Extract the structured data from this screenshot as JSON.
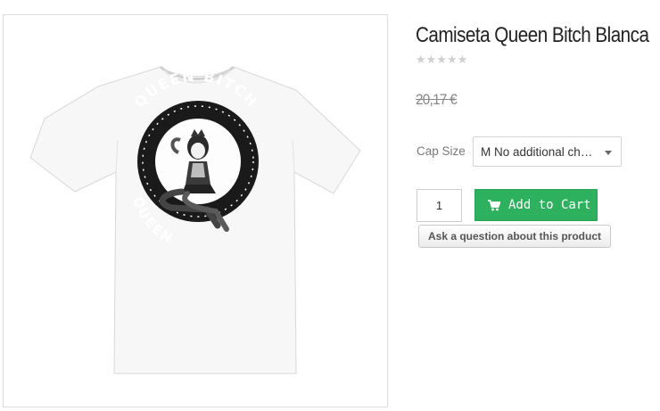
{
  "product": {
    "title": "Camiseta Queen Bitch Blanca",
    "rating_stars": "★★★★★",
    "rating_value": 0,
    "price": "20,17 €"
  },
  "logo_text": {
    "top": "QUEEN BITCH",
    "bottom": "QUEEN"
  },
  "options": {
    "label": "Cap Size",
    "selected": "M No additional charge"
  },
  "cart": {
    "quantity": "1",
    "add_label": "Add to Cart",
    "icon": "shopping-cart-icon"
  },
  "ask_label": "Ask a question about this product",
  "colors": {
    "accent": "#2eb15f",
    "price": "#888888",
    "stars": "#cfcfcf"
  }
}
